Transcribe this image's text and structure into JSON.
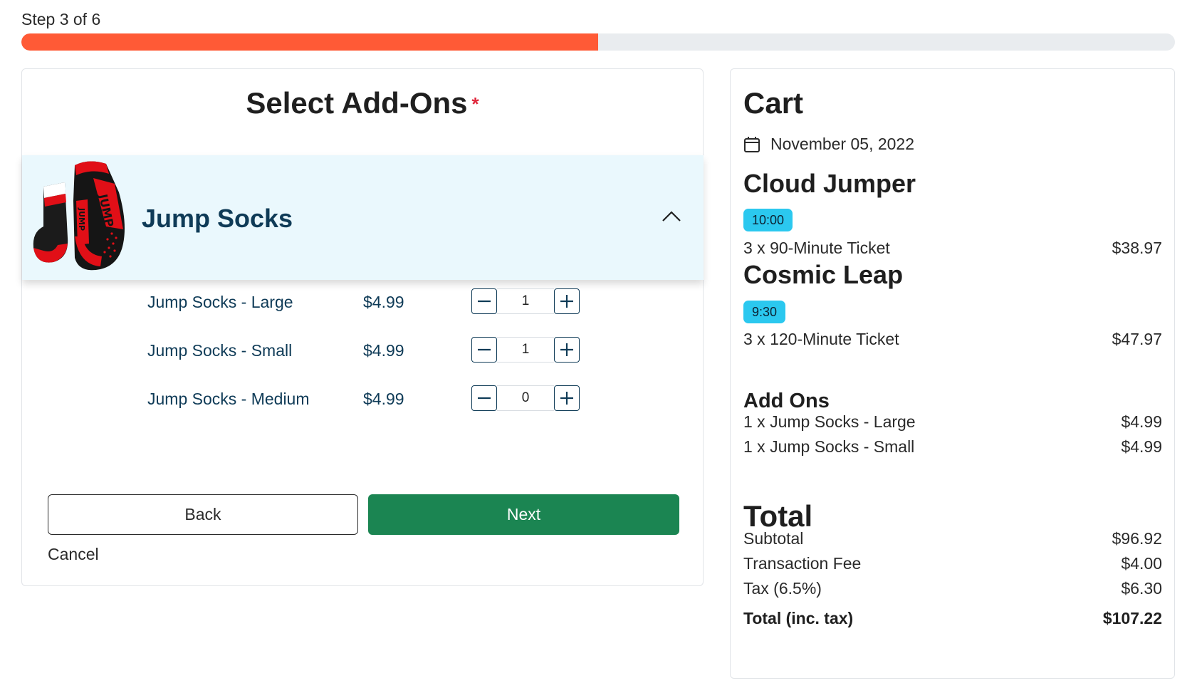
{
  "progress": {
    "label": "Step 3 of 6",
    "current_step": 3,
    "total_steps": 6,
    "fraction": 0.5,
    "fill_color": "#ff5a36",
    "track_color": "#e9ecef"
  },
  "addons": {
    "title": "Select Add-Ons",
    "required_marker": "*",
    "product": {
      "name": "Jump Socks",
      "expanded": true,
      "image_icon": "jump-socks-product-image",
      "toggle_icon": "chevron-up-icon"
    },
    "variants": [
      {
        "name": "Jump Socks - Large",
        "price": "$4.99",
        "quantity": "1"
      },
      {
        "name": "Jump Socks - Small",
        "price": "$4.99",
        "quantity": "1"
      },
      {
        "name": "Jump Socks - Medium",
        "price": "$4.99",
        "quantity": "0"
      }
    ],
    "buttons": {
      "back": "Back",
      "next": "Next",
      "cancel": "Cancel"
    },
    "colors": {
      "header_bg": "#eaf8fd",
      "text_navy": "#0f3b57",
      "next_green": "#1b8552",
      "required_red": "#e0263b"
    }
  },
  "cart": {
    "title": "Cart",
    "date": "November 05, 2022",
    "date_icon": "calendar-icon",
    "events": [
      {
        "name": "Cloud Jumper",
        "time": "10:00",
        "line": "3 x 90-Minute Ticket",
        "amount": "$38.97"
      },
      {
        "name": "Cosmic Leap",
        "time": "9:30",
        "line": "3 x 120-Minute Ticket",
        "amount": "$47.97"
      }
    ],
    "addons_heading": "Add Ons",
    "addon_lines": [
      {
        "line": "1 x Jump Socks - Large",
        "amount": "$4.99"
      },
      {
        "line": "1 x Jump Socks - Small",
        "amount": "$4.99"
      }
    ],
    "total_heading": "Total",
    "summary": [
      {
        "label": "Subtotal",
        "amount": "$96.92"
      },
      {
        "label": "Transaction Fee",
        "amount": "$4.00"
      },
      {
        "label": "Tax (6.5%)",
        "amount": "$6.30"
      }
    ],
    "grand_total": {
      "label": "Total (inc. tax)",
      "amount": "$107.22"
    },
    "badge_color": "#2bc8ef"
  }
}
